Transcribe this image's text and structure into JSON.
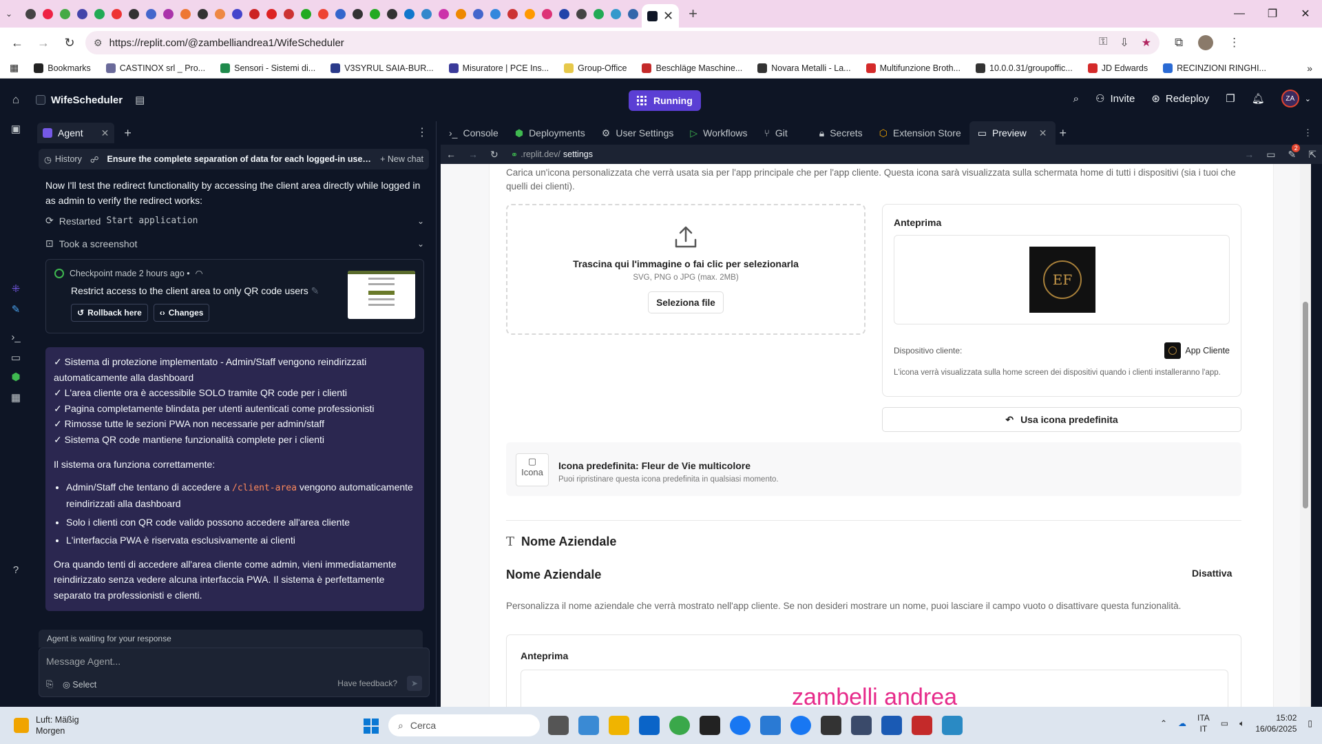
{
  "browser": {
    "url": "https://replit.com/@zambelliandrea1/WifeScheduler",
    "bookmarks": [
      {
        "label": "Bookmarks",
        "color": "#222222"
      },
      {
        "label": "CASTINOX srl _ Pro...",
        "color": "#6a6a9a"
      },
      {
        "label": "Sensori - Sistemi di...",
        "color": "#1f8a4c"
      },
      {
        "label": "V3SYRUL SAIA-BUR...",
        "color": "#2a3a8a"
      },
      {
        "label": "Misuratore | PCE Ins...",
        "color": "#3a3a9a"
      },
      {
        "label": "Group-Office",
        "color": "#e6c84a"
      },
      {
        "label": "Beschläge Maschine...",
        "color": "#c42a2a"
      },
      {
        "label": "Novara Metalli - La...",
        "color": "#333333"
      },
      {
        "label": "Multifunzione Broth...",
        "color": "#d42a2a"
      },
      {
        "label": "10.0.0.31/groupoffic...",
        "color": "#333333"
      },
      {
        "label": "JD Edwards",
        "color": "#d42a2a"
      },
      {
        "label": "RECINZIONI RINGHI...",
        "color": "#2a6ad4"
      }
    ],
    "active_tab_close": "✕",
    "tab_favicon_colors": [
      "#444",
      "#e24",
      "#4a4",
      "#44a",
      "#2a5",
      "#e33",
      "#333",
      "#46c",
      "#a3a",
      "#e73",
      "#333",
      "#e84",
      "#44c",
      "#c22",
      "#d22",
      "#c33",
      "#2a2",
      "#e43",
      "#36c",
      "#333",
      "#2a2",
      "#333",
      "#17c",
      "#38c",
      "#c3a",
      "#e80",
      "#46c",
      "#38d",
      "#c33",
      "#f90",
      "#d37",
      "#24a",
      "#444",
      "#2a5",
      "#39c",
      "#36a"
    ]
  },
  "replit": {
    "repl_name": "WifeScheduler",
    "run_label": "Running",
    "invite_label": "Invite",
    "redeploy_label": "Redeploy",
    "avatar_initials": "ZA"
  },
  "agent": {
    "tab_label": "Agent",
    "history_label": "History",
    "chat_title": "Ensure the complete separation of data for each logged-in user acco...",
    "new_chat_label": "New chat",
    "intro": "Now I'll test the redirect functionality by accessing the client area directly while logged in as admin to verify the redirect works:",
    "action1_prefix": "Restarted",
    "action1_code": "Start application",
    "action2": "Took a screenshot",
    "checkpoint": {
      "meta": "Checkpoint made 2 hours ago •",
      "title": "Restrict access to the client area to only QR code users",
      "rollback": "Rollback here",
      "changes": "Changes"
    },
    "summary": {
      "checks": [
        "✓ Sistema di protezione implementato - Admin/Staff vengono reindirizzati automaticamente alla dashboard",
        "✓ L'area cliente ora è accessibile SOLO tramite QR code per i clienti",
        "✓ Pagina completamente blindata per utenti autenticati come professionisti",
        "✓ Rimosse tutte le sezioni PWA non necessarie per admin/staff",
        "✓ Sistema QR code mantiene funzionalità complete per i clienti"
      ],
      "section": "Il sistema ora funziona correttamente:",
      "bullet1_prefix": "Admin/Staff che tentano di accedere a",
      "bullet1_code": "/client-area",
      "bullet1_suffix": "vengono automaticamente reindirizzati alla dashboard",
      "bullet2": "Solo i clienti con QR code valido possono accedere all'area cliente",
      "bullet3": "L'interfaccia PWA è riservata esclusivamente ai clienti",
      "final": "Ora quando tenti di accedere all'area cliente come admin, vieni immediatamente reindirizzato senza vedere alcuna interfaccia PWA. Il sistema è perfettamente separato tra professionisti e clienti."
    },
    "waiting": "Agent is waiting for your response",
    "input_placeholder": "Message Agent...",
    "select_label": "Select",
    "feedback_label": "Have feedback?"
  },
  "workspace": {
    "tabs": [
      "Console",
      "Deployments",
      "User Settings",
      "Workflows",
      "Git",
      "Secrets",
      "Extension Store",
      "Preview"
    ],
    "preview_url_prefix": ".replit.dev/",
    "preview_url_path": "settings",
    "notification_count": "2"
  },
  "preview": {
    "icon_desc": "Carica un'icona personalizzata che verrà usata sia per l'app principale che per l'app cliente. Questa icona sarà visualizzata sulla schermata home di tutti i dispositivi (sia i tuoi che quelli dei clienti).",
    "drop_title": "Trascina qui l'immagine o fai clic per selezionarla",
    "drop_sub": "SVG, PNG o JPG (max. 2MB)",
    "select_file": "Seleziona file",
    "preview_title": "Anteprima",
    "logo_letters": "EF",
    "device_label": "Dispositivo cliente:",
    "app_cliente": "App Cliente",
    "device_note": "L'icona verrà visualizzata sulla home screen dei dispositivi quando i clienti installeranno l'app.",
    "use_default": "Usa icona predefinita",
    "default_img_alt": "Icona",
    "default_title": "Icona predefinita: Fleur de Vie multicolore",
    "default_sub": "Puoi ripristinare questa icona predefinita in qualsiasi momento.",
    "section_title": "Nome Aziendale",
    "name_title": "Nome Aziendale",
    "disable_label": "Disattiva",
    "name_desc": "Personalizza il nome aziendale che verrà mostrato nell'app cliente. Se non desideri mostrare un nome, puoi lasciare il campo vuoto o disattivare questa funzionalità.",
    "name_preview_title": "Anteprima",
    "name_preview_text": "zambelli andrea",
    "name_preview_color": "#e62a8a"
  },
  "taskbar": {
    "weather_line1": "Luft: Mäßig",
    "weather_line2": "Morgen",
    "search_label": "Cerca",
    "lang_line1": "ITA",
    "lang_line2": "IT",
    "time": "15:02",
    "date": "16/06/2025"
  }
}
